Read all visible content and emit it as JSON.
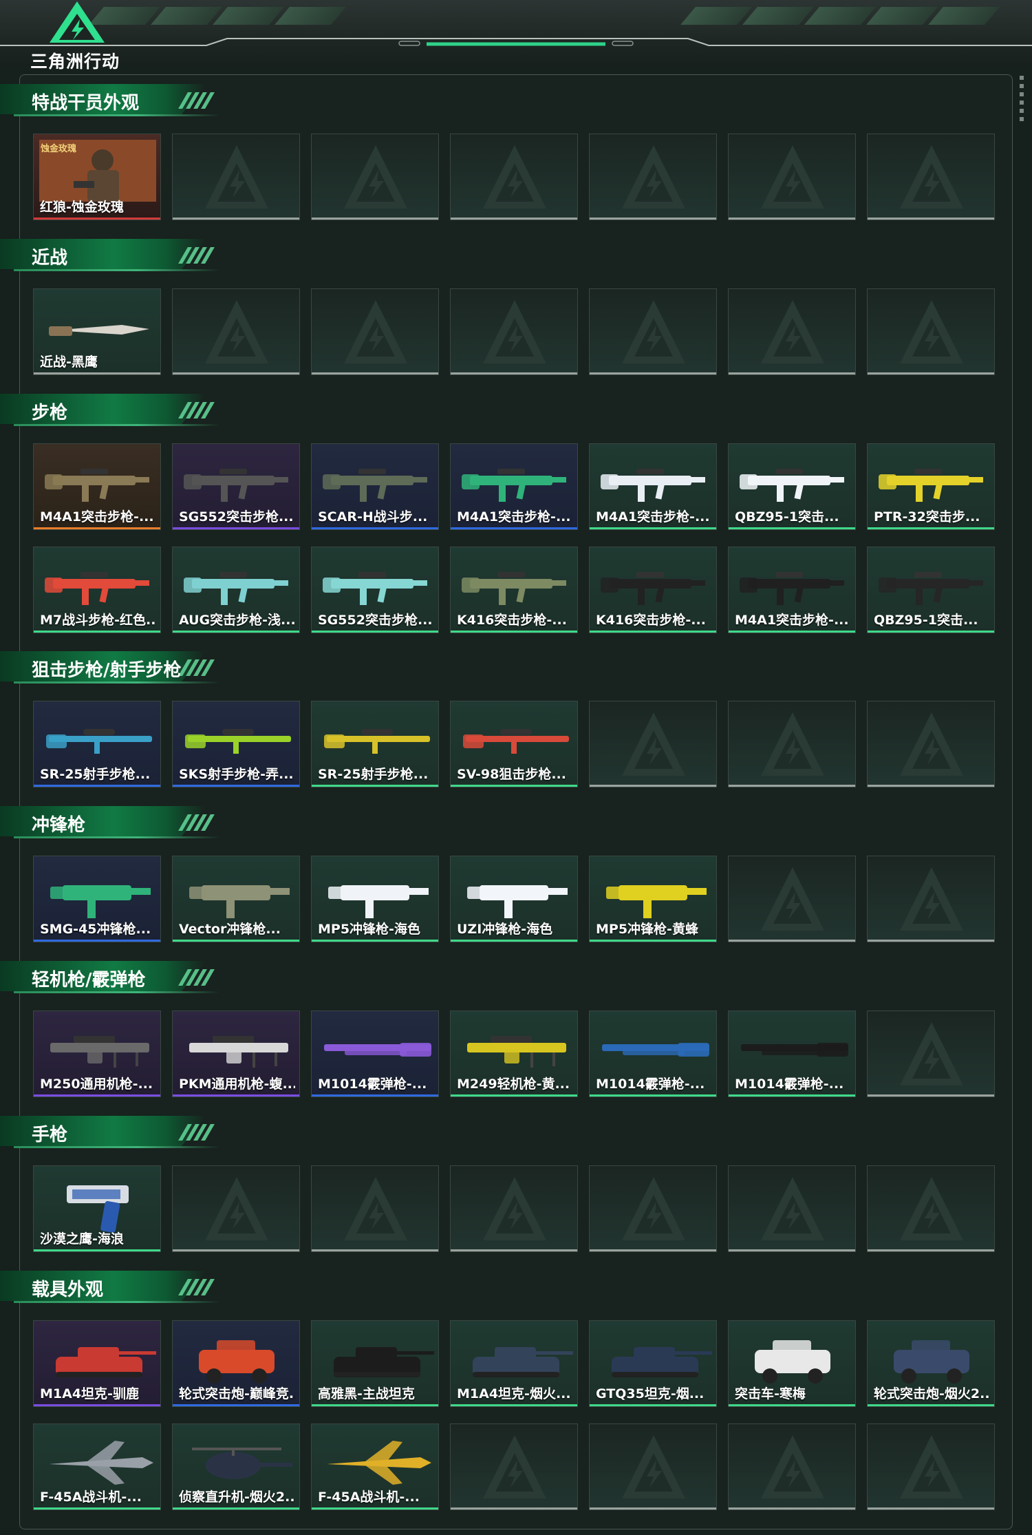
{
  "app": {
    "logo_text": "三角洲行动"
  },
  "colors": {
    "red": "#d33a3a",
    "orange": "#e87d2a",
    "purple": "#7a4de2",
    "blue": "#2f6ae0",
    "green": "#3fd98a",
    "empty": "#9aa39f"
  },
  "sections": [
    {
      "title": "特战干员外观",
      "items": [
        {
          "label": "红狼-蚀金玫瑰",
          "rarity": "red",
          "icon": "operator-icon",
          "badge": "蚀金玫瑰"
        },
        null,
        null,
        null,
        null,
        null,
        null
      ]
    },
    {
      "title": "近战",
      "items": [
        {
          "label": "近战-黑鹰",
          "rarity": "none",
          "icon": "knife-icon"
        },
        null,
        null,
        null,
        null,
        null,
        null
      ]
    },
    {
      "title": "步枪",
      "items": [
        {
          "label": "M4A1突击步枪-...",
          "rarity": "orange",
          "icon": "rifle-icon",
          "tint": "#8a7a55"
        },
        {
          "label": "SG552突击步枪...",
          "rarity": "purple",
          "icon": "rifle-icon",
          "tint": "#555555"
        },
        {
          "label": "SCAR-H战斗步...",
          "rarity": "blue",
          "icon": "rifle-icon",
          "tint": "#5d6b57"
        },
        {
          "label": "M4A1突击步枪-...",
          "rarity": "blue",
          "icon": "rifle-icon",
          "tint": "#2fb37a"
        },
        {
          "label": "M4A1突击步枪-...",
          "rarity": "green",
          "icon": "rifle-icon",
          "tint": "#e9eef5"
        },
        {
          "label": "QBZ95-1突击...",
          "rarity": "green",
          "icon": "rifle-icon",
          "tint": "#f0f4f8"
        },
        {
          "label": "PTR-32突击步...",
          "rarity": "green",
          "icon": "rifle-icon",
          "tint": "#e4d22a"
        },
        {
          "label": "M7战斗步枪-红色...",
          "rarity": "green",
          "icon": "rifle-icon",
          "tint": "#e24a3a"
        },
        {
          "label": "AUG突击步枪-浅...",
          "rarity": "green",
          "icon": "rifle-icon",
          "tint": "#7fd0d0"
        },
        {
          "label": "SG552突击步枪...",
          "rarity": "green",
          "icon": "rifle-icon",
          "tint": "#86d6d4"
        },
        {
          "label": "K416突击步枪-...",
          "rarity": "green",
          "icon": "rifle-icon",
          "tint": "#7d8a62"
        },
        {
          "label": "K416突击步枪-...",
          "rarity": "green",
          "icon": "rifle-icon",
          "tint": "#222222"
        },
        {
          "label": "M4A1突击步枪-...",
          "rarity": "green",
          "icon": "rifle-icon",
          "tint": "#202020"
        },
        {
          "label": "QBZ95-1突击...",
          "rarity": "green",
          "icon": "rifle-icon",
          "tint": "#262626"
        }
      ]
    },
    {
      "title": "狙击步枪/射手步枪",
      "items": [
        {
          "label": "SR-25射手步枪...",
          "rarity": "blue",
          "icon": "sniper-icon",
          "tint": "#3aa0c8"
        },
        {
          "label": "SKS射手步枪-弄...",
          "rarity": "blue",
          "icon": "sniper-icon",
          "tint": "#9bd22a"
        },
        {
          "label": "SR-25射手步枪...",
          "rarity": "green",
          "icon": "sniper-icon",
          "tint": "#d8c22a"
        },
        {
          "label": "SV-98狙击步枪...",
          "rarity": "green",
          "icon": "sniper-icon",
          "tint": "#d84a3a"
        },
        null,
        null,
        null
      ]
    },
    {
      "title": "冲锋枪",
      "items": [
        {
          "label": "SMG-45冲锋枪...",
          "rarity": "blue",
          "icon": "smg-icon",
          "tint": "#2fb37a"
        },
        {
          "label": "Vector冲锋枪...",
          "rarity": "green",
          "icon": "smg-icon",
          "tint": "#8e9276"
        },
        {
          "label": "MP5冲锋枪-海色",
          "rarity": "green",
          "icon": "smg-icon",
          "tint": "#f0f3f7"
        },
        {
          "label": "UZI冲锋枪-海色",
          "rarity": "green",
          "icon": "smg-icon",
          "tint": "#f2f5f9"
        },
        {
          "label": "MP5冲锋枪-黄蜂",
          "rarity": "green",
          "icon": "smg-icon",
          "tint": "#e0d020"
        },
        null,
        null
      ]
    },
    {
      "title": "轻机枪/霰弹枪",
      "items": [
        {
          "label": "M250通用机枪-...",
          "rarity": "purple",
          "icon": "lmg-icon",
          "tint": "#6a6a6a"
        },
        {
          "label": "PKM通用机枪-蝮...",
          "rarity": "purple",
          "icon": "lmg-icon",
          "tint": "#d8d8d8"
        },
        {
          "label": "M1014霰弹枪-...",
          "rarity": "blue",
          "icon": "shotgun-icon",
          "tint": "#8a5ad8"
        },
        {
          "label": "M249轻机枪-黄...",
          "rarity": "green",
          "icon": "lmg-icon",
          "tint": "#d8c620"
        },
        {
          "label": "M1014霰弹枪-...",
          "rarity": "green",
          "icon": "shotgun-icon",
          "tint": "#2a6ab8"
        },
        {
          "label": "M1014霰弹枪-...",
          "rarity": "green",
          "icon": "shotgun-icon",
          "tint": "#1c1c1c"
        },
        null
      ]
    },
    {
      "title": "手枪",
      "items": [
        {
          "label": "沙漠之鹰-海浪",
          "rarity": "green",
          "icon": "pistol-icon",
          "tint": "#2a5ab0"
        },
        null,
        null,
        null,
        null,
        null,
        null
      ]
    },
    {
      "title": "载具外观",
      "items": [
        {
          "label": "M1A4坦克-驯鹿",
          "rarity": "purple",
          "icon": "tank-icon",
          "tint": "#c83a32"
        },
        {
          "label": "轮式突击炮-巅峰竞...",
          "rarity": "blue",
          "icon": "car-icon",
          "tint": "#d84a2a"
        },
        {
          "label": "高雅黑-主战坦克",
          "rarity": "green",
          "icon": "tank-icon",
          "tint": "#1c1c1c"
        },
        {
          "label": "M1A4坦克-烟火...",
          "rarity": "green",
          "icon": "tank-icon",
          "tint": "#33435a"
        },
        {
          "label": "GTQ35坦克-烟...",
          "rarity": "green",
          "icon": "tank-icon",
          "tint": "#2a3a55"
        },
        {
          "label": "突击车-寒梅",
          "rarity": "green",
          "icon": "car-icon",
          "tint": "#e8e8e8"
        },
        {
          "label": "轮式突击炮-烟火2...",
          "rarity": "green",
          "icon": "car-icon",
          "tint": "#3a4a6a"
        },
        {
          "label": "F-45A战斗机-...",
          "rarity": "green",
          "icon": "jet-icon",
          "tint": "#9aa0a8"
        },
        {
          "label": "侦察直升机-烟火2...",
          "rarity": "green",
          "icon": "helicopter-icon",
          "tint": "#2a3346"
        },
        {
          "label": "F-45A战斗机-...",
          "rarity": "green",
          "icon": "jet-icon",
          "tint": "#e0b028"
        },
        null,
        null,
        null,
        null
      ]
    }
  ]
}
